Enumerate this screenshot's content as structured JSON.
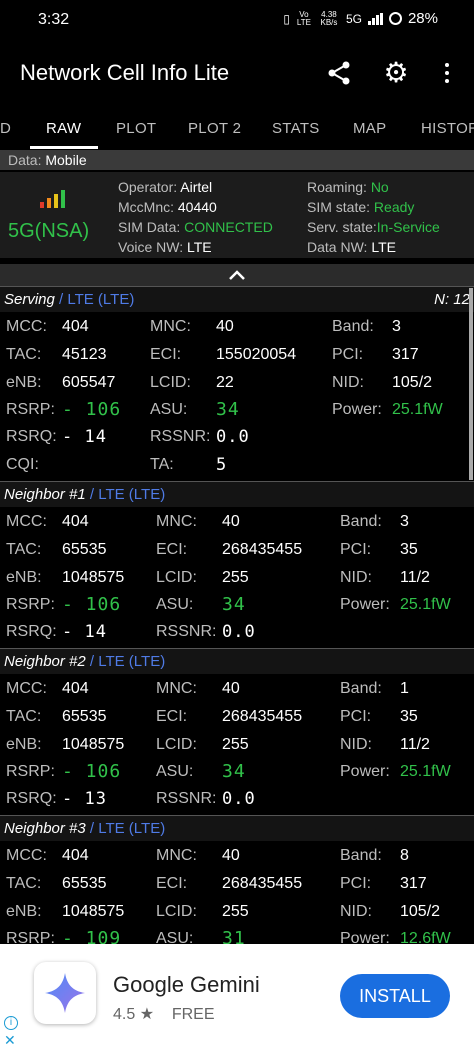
{
  "status": {
    "time": "3:32",
    "volte": "Vo LTE",
    "speed": "4.38 KB/s",
    "net": "5G",
    "battery": "28%"
  },
  "app": {
    "title": "Network Cell Info Lite"
  },
  "tabs": [
    "D",
    "RAW",
    "PLOT",
    "PLOT 2",
    "STATS",
    "MAP",
    "HISTOR"
  ],
  "data_row": {
    "label": "Data:",
    "value": "Mobile"
  },
  "summary": {
    "network_type": "5G(NSA)",
    "operator_k": "Operator:",
    "operator_v": "Airtel",
    "mccmnc_k": "MccMnc:",
    "mccmnc_v": "40440",
    "simdata_k": "SIM Data:",
    "simdata_v": "CONNECTED",
    "voice_k": "Voice NW:",
    "voice_v": "LTE",
    "roaming_k": "Roaming:",
    "roaming_v": "No",
    "simstate_k": "SIM state:",
    "simstate_v": "Ready",
    "serv_k": "Serv. state:",
    "serv_v": "In-Service",
    "datanw_k": "Data NW:",
    "datanw_v": "LTE"
  },
  "serving": {
    "title": "Serving",
    "sub": "/ LTE (LTE)",
    "n": "N: 12",
    "mcc": "404",
    "mnc": "40",
    "band": "3",
    "tac": "45123",
    "eci": "155020054",
    "pci": "317",
    "enb": "605547",
    "lcid": "22",
    "nid": "105/2",
    "rsrp": "- 106",
    "asu": "34",
    "power": "25.1fW",
    "rsrq": "- 14",
    "rssnr": "0.0",
    "cqi": "",
    "ta": "5"
  },
  "neighbor1": {
    "title": "Neighbor #1",
    "sub": "/ LTE (LTE)",
    "mcc": "404",
    "mnc": "40",
    "band": "3",
    "tac": "65535",
    "eci": "268435455",
    "pci": "35",
    "enb": "1048575",
    "lcid": "255",
    "nid": "11/2",
    "rsrp": "- 106",
    "asu": "34",
    "power": "25.1fW",
    "rsrq": "- 14",
    "rssnr": "0.0"
  },
  "neighbor2": {
    "title": "Neighbor #2",
    "sub": "/ LTE (LTE)",
    "mcc": "404",
    "mnc": "40",
    "band": "1",
    "tac": "65535",
    "eci": "268435455",
    "pci": "35",
    "enb": "1048575",
    "lcid": "255",
    "nid": "11/2",
    "rsrp": "- 106",
    "asu": "34",
    "power": "25.1fW",
    "rsrq": "- 13",
    "rssnr": "0.0"
  },
  "neighbor3": {
    "title": "Neighbor #3",
    "sub": "/ LTE (LTE)",
    "mcc": "404",
    "mnc": "40",
    "band": "8",
    "tac": "65535",
    "eci": "268435455",
    "pci": "317",
    "enb": "1048575",
    "lcid": "255",
    "nid": "105/2",
    "rsrp": "- 109",
    "asu": "31",
    "power": "12.6fW"
  },
  "labels": {
    "mcc": "MCC:",
    "mnc": "MNC:",
    "band": "Band:",
    "tac": "TAC:",
    "eci": "ECI:",
    "pci": "PCI:",
    "enb": "eNB:",
    "lcid": "LCID:",
    "nid": "NID:",
    "rsrp": "RSRP:",
    "asu": "ASU:",
    "power": "Power:",
    "rsrq": "RSRQ:",
    "rssnr": "RSSNR:",
    "cqi": "CQI:",
    "ta": "TA:"
  },
  "ad": {
    "app_name": "Google Gemini",
    "rating": "4.5 ★",
    "price": "FREE",
    "install": "INSTALL"
  },
  "colors": {
    "green": "#31c14a",
    "blue": "#4f7be6",
    "install_blue": "#1a6ee0"
  }
}
